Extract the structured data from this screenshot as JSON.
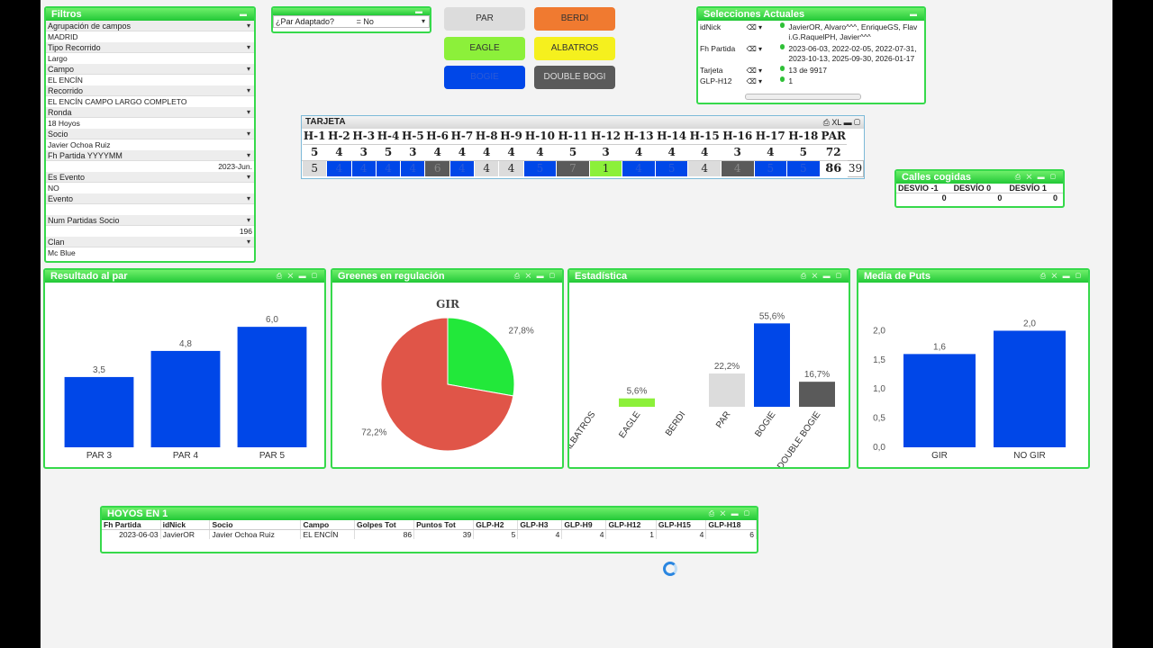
{
  "colors": {
    "green": "#22c837",
    "blue": "#0047e8",
    "red": "#e05548"
  },
  "filters": {
    "title": "Filtros",
    "items": [
      {
        "label": "Agrupación de campos",
        "value": "MADRID"
      },
      {
        "label": "Tipo Recorrido",
        "value": "Largo"
      },
      {
        "label": "Campo",
        "value": "EL ENCÍN"
      },
      {
        "label": "Recorrido",
        "value": "EL ENCÍN CAMPO LARGO COMPLETO"
      },
      {
        "label": "Ronda",
        "value": "18 Hoyos"
      },
      {
        "label": "Socio",
        "value": "Javier Ochoa Ruiz"
      },
      {
        "label": "Fh Partida YYYYMM",
        "value": "2023-Jun."
      },
      {
        "label": "Es Evento",
        "value": "NO"
      },
      {
        "label": "Evento",
        "value": ""
      },
      {
        "label": "Num Partidas Socio",
        "value": "196"
      },
      {
        "label": "Clan",
        "value": "Mc Blue"
      }
    ]
  },
  "par_adaptado": {
    "label": "¿Par Adaptado?",
    "value": "= No"
  },
  "buttons": [
    {
      "label": "PAR",
      "bg": "#dcdcdc"
    },
    {
      "label": "BERDI",
      "bg": "#f07a30"
    },
    {
      "label": "EAGLE",
      "bg": "#8cf03a"
    },
    {
      "label": "ALBATROS",
      "bg": "#f5f01e"
    },
    {
      "label": "BOGIE",
      "bg": "#0047e8"
    },
    {
      "label": "DOUBLE BOGI",
      "bg": "#5a5a5a"
    }
  ],
  "selections": {
    "title": "Selecciones Actuales",
    "rows": [
      {
        "key": "idNick",
        "value": "JavierOR, Alvaro^^^, EnriqueGS, Flav i.G.RaquelPH, Javier^^^"
      },
      {
        "key": "Fh Partida",
        "value": "2023-06-03, 2022-02-05, 2022-07-31, 2023-10-13, 2025-09-30, 2026-01-17"
      },
      {
        "key": "Tarjeta",
        "value": "13 de 9917"
      },
      {
        "key": "GLP-H12",
        "value": "1"
      }
    ]
  },
  "tarjeta": {
    "title": "TARJETA",
    "tools": "XL",
    "headers": [
      "H-1",
      "H-2",
      "H-3",
      "H-4",
      "H-5",
      "H-6",
      "H-7",
      "H-8",
      "H-9",
      "H-10",
      "H-11",
      "H-12",
      "H-13",
      "H-14",
      "H-15",
      "H-16",
      "H-17",
      "H-18",
      "PAR"
    ],
    "par": [
      "5",
      "4",
      "3",
      "5",
      "3",
      "4",
      "4",
      "4",
      "4",
      "4",
      "5",
      "3",
      "4",
      "4",
      "4",
      "3",
      "4",
      "5",
      "72"
    ],
    "score": [
      "5",
      "4",
      "4",
      "4",
      "4",
      "6",
      "4",
      "4",
      "4",
      "5",
      "7",
      "1",
      "4",
      "5",
      "4",
      "4",
      "5",
      "5",
      "86"
    ],
    "score_colors": [
      "#dcdcdc",
      "#0047e8",
      "#0047e8",
      "#0047e8",
      "#0047e8",
      "#5a5a5a",
      "#0047e8",
      "#dcdcdc",
      "#dcdcdc",
      "#0047e8",
      "#5a5a5a",
      "#8cf03a",
      "#0047e8",
      "#0047e8",
      "#dcdcdc",
      "#5a5a5a",
      "#0047e8",
      "#0047e8",
      "#fff"
    ],
    "points": "39"
  },
  "calles": {
    "title": "Calles cogidas",
    "headers": [
      "DESVIO -1",
      "DESVÍO 0",
      "DESVÍO 1"
    ],
    "values": [
      "0",
      "0",
      "0"
    ]
  },
  "resultado": {
    "title": "Resultado al par"
  },
  "greenes": {
    "title": "Greenes en regulación"
  },
  "estadistica": {
    "title": "Estadística"
  },
  "puts": {
    "title": "Media de Puts"
  },
  "hoyos": {
    "title": "HOYOS EN 1",
    "headers": [
      "Fh Partida",
      "idNick",
      "Socio",
      "Campo",
      "Golpes Tot",
      "Puntos Tot",
      "GLP-H2",
      "GLP-H3",
      "GLP-H9",
      "GLP-H12",
      "GLP-H15",
      "GLP-H18"
    ],
    "row": [
      "2023-06-03",
      "JavierOR",
      "Javier Ochoa Ruiz",
      "EL ENCÍN",
      "86",
      "39",
      "5",
      "4",
      "4",
      "1",
      "4",
      "6"
    ]
  },
  "chart_data": [
    {
      "type": "bar",
      "categories": [
        "PAR 3",
        "PAR 4",
        "PAR 5"
      ],
      "values": [
        3.5,
        4.8,
        6.0
      ],
      "labels": [
        "3,5",
        "4,8",
        "6,0"
      ],
      "ylim": [
        0,
        6.5
      ],
      "color": "#0047e8"
    },
    {
      "type": "pie",
      "title": "GIR",
      "values": [
        27.8,
        72.2
      ],
      "labels": [
        "27,8%",
        "72,2%"
      ],
      "colors": [
        "#22e83a",
        "#e05548"
      ]
    },
    {
      "type": "bar",
      "categories": [
        "ALBATROS",
        "EAGLE",
        "BERDI",
        "PAR",
        "BOGIE",
        "DOUBLE BOGIE"
      ],
      "values": [
        0,
        5.6,
        0,
        22.2,
        55.6,
        16.7
      ],
      "labels": [
        "",
        "5,6%",
        "",
        "22,2%",
        "55,6%",
        "16,7%"
      ],
      "colors": [
        "#f5f01e",
        "#8cf03a",
        "#f07a30",
        "#dcdcdc",
        "#0047e8",
        "#5a5a5a"
      ],
      "ylim": [
        0,
        60
      ]
    },
    {
      "type": "bar",
      "categories": [
        "GIR",
        "NO GIR"
      ],
      "values": [
        1.6,
        2.0
      ],
      "labels": [
        "1,6",
        "2,0"
      ],
      "yticks": [
        "0,0",
        "0,5",
        "1,0",
        "1,5",
        "2,0"
      ],
      "ylim": [
        0,
        2.1
      ],
      "color": "#0047e8"
    }
  ]
}
